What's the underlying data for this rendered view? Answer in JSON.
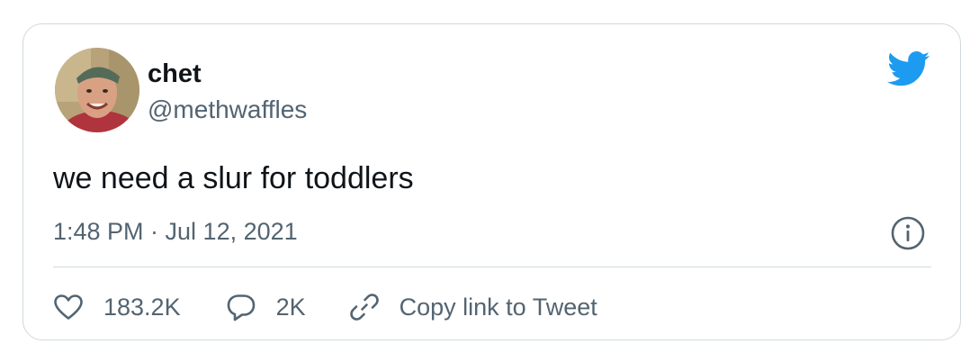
{
  "author": {
    "display_name": "chet",
    "handle": "@methwaffles",
    "avatar_icon": "profile-photo"
  },
  "tweet": {
    "text": "we need a slur for toddlers",
    "timestamp": "1:48 PM · Jul 12, 2021"
  },
  "actions": {
    "like_count": "183.2K",
    "reply_count": "2K",
    "copy_link_label": "Copy link to Tweet"
  },
  "icons": {
    "brand": "twitter-bird-icon",
    "info": "info-icon",
    "like": "heart-icon",
    "reply": "speech-bubble-icon",
    "copy": "link-icon"
  },
  "colors": {
    "brand_blue": "#1d9bf0",
    "secondary_text": "#536471",
    "primary_text": "#0f1419",
    "border": "#cfd9de"
  }
}
